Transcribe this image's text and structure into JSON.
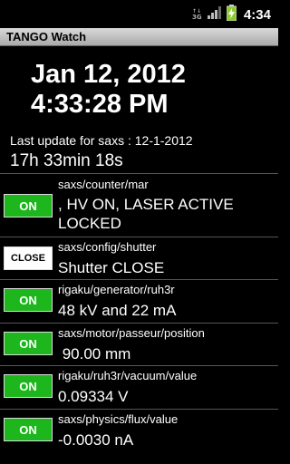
{
  "status_bar": {
    "network_label": "3G",
    "clock": "4:34",
    "icons": [
      "3g-data-icon",
      "signal-strength-icon",
      "battery-charging-icon"
    ],
    "battery_color": "#8ccc2c"
  },
  "app": {
    "title": "TANGO Watch"
  },
  "datetime": {
    "date": "Jan 12, 2012",
    "time": "4:33:28 PM"
  },
  "update": {
    "label": "Last update for saxs : 12-1-2012",
    "elapsed": "17h 33min 18s"
  },
  "rows": [
    {
      "button": "ON",
      "state": "on",
      "path": "saxs/counter/mar",
      "value": ", HV ON, LASER ACTIVE LOCKED"
    },
    {
      "button": "CLOSE",
      "state": "close",
      "path": "saxs/config/shutter",
      "value": "Shutter CLOSE"
    },
    {
      "button": "ON",
      "state": "on",
      "path": "rigaku/generator/ruh3r",
      "value": "48 kV and 22 mA"
    },
    {
      "button": "ON",
      "state": "on",
      "path": "saxs/motor/passeur/position",
      "value": " 90.00 mm"
    },
    {
      "button": "ON",
      "state": "on",
      "path": "rigaku/ruh3r/vacuum/value",
      "value": "0.09334 V"
    },
    {
      "button": "ON",
      "state": "on",
      "path": "saxs/physics/flux/value",
      "value": "-0.0030 nA"
    }
  ],
  "colors": {
    "on_button": "#1db61d",
    "close_button": "#ffffff",
    "background": "#000000"
  }
}
